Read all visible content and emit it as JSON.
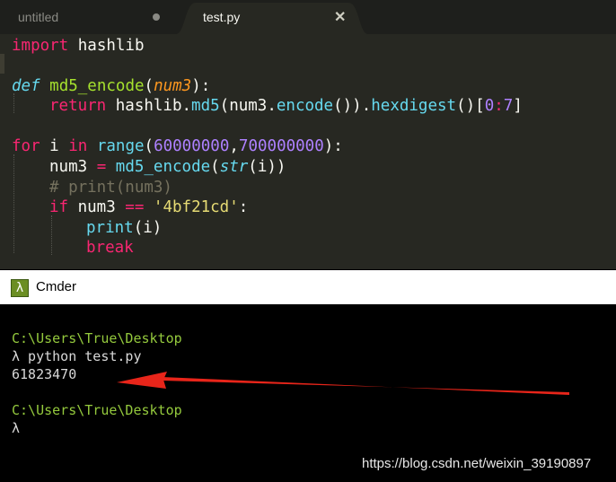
{
  "tabs": [
    {
      "label": "untitled",
      "modified": true
    },
    {
      "label": "test.py",
      "active": true,
      "close": "✕"
    }
  ],
  "code": {
    "l1": [
      "import",
      " hashlib"
    ],
    "l3": [
      "def",
      " ",
      "md5_encode",
      "(",
      "num3",
      "):"
    ],
    "l4": [
      "return",
      " hashlib.",
      "md5",
      "(num3.",
      "encode",
      "()).",
      "hexdigest",
      "()[",
      "0",
      ":",
      "7",
      "]"
    ],
    "l6": [
      "for",
      " i ",
      "in",
      " ",
      "range",
      "(",
      "60000000",
      ",",
      "700000000",
      "):"
    ],
    "l7": [
      "num3 ",
      "=",
      " ",
      "md5_encode",
      "(",
      "str",
      "(i))"
    ],
    "l8": [
      "# print(num3)"
    ],
    "l9": [
      "if",
      " num3 ",
      "==",
      " ",
      "'4bf21cd'",
      ":"
    ],
    "l10": [
      "print",
      "(i)"
    ],
    "l11": [
      "break"
    ]
  },
  "cmder": {
    "title": "Cmder",
    "logo": "λ",
    "lines": {
      "path1": "C:\\Users\\True\\Desktop",
      "cmd": "λ python test.py",
      "output": "61823470",
      "path2": "C:\\Users\\True\\Desktop",
      "prompt": "λ"
    }
  },
  "colors": {
    "arrow": "#e8251a",
    "path": "#94c93d",
    "editor_bg": "#272822"
  },
  "watermark": "https://blog.csdn.net/weixin_39190897"
}
